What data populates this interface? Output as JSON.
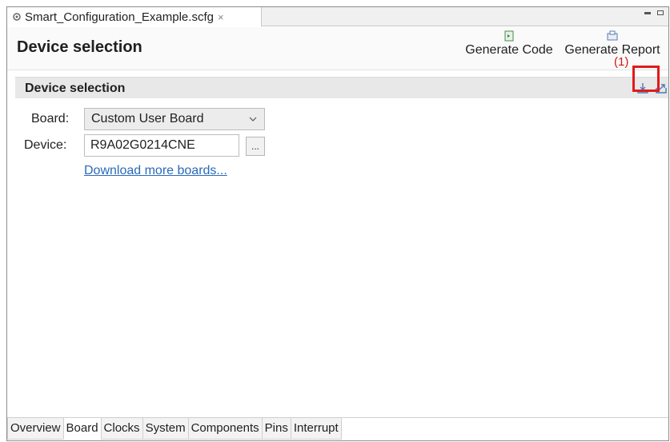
{
  "editor": {
    "tab_title": "Smart_Configuration_Example.scfg",
    "tab_close": "×"
  },
  "header": {
    "title": "Device selection",
    "generate_code_label": "Generate Code",
    "generate_report_label": "Generate Report"
  },
  "section": {
    "title": "Device selection",
    "annotation": "(1)"
  },
  "form": {
    "board_label": "Board:",
    "board_value": "Custom User Board",
    "device_label": "Device:",
    "device_value": "R9A02G0214CNE",
    "browse_label": "...",
    "download_link": "Download more boards..."
  },
  "bottom_tabs": [
    "Overview",
    "Board",
    "Clocks",
    "System",
    "Components",
    "Pins",
    "Interrupt"
  ],
  "active_tab": "Board",
  "colors": {
    "highlight": "#e01b1b",
    "link": "#2a6ab8"
  },
  "icons": {
    "tab": "gear-icon",
    "generate_code": "generate-code-icon",
    "generate_report": "generate-report-icon",
    "import": "import-board-icon",
    "export": "export-board-icon"
  }
}
